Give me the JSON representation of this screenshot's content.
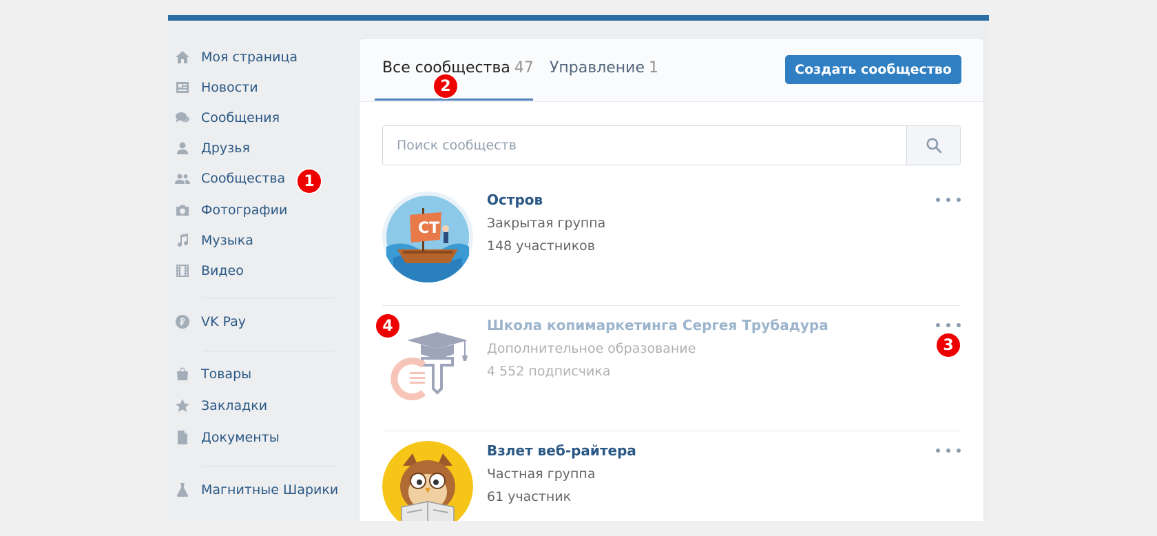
{
  "sidebar": {
    "items": [
      {
        "label": "Моя страница",
        "icon": "home-icon"
      },
      {
        "label": "Новости",
        "icon": "news-icon"
      },
      {
        "label": "Сообщения",
        "icon": "messages-icon"
      },
      {
        "label": "Друзья",
        "icon": "friend-icon"
      },
      {
        "label": "Сообщества",
        "icon": "communities-icon"
      },
      {
        "label": "Фотографии",
        "icon": "camera-icon"
      },
      {
        "label": "Музыка",
        "icon": "music-note-icon"
      },
      {
        "label": "Видео",
        "icon": "film-icon"
      },
      {
        "label": "VK Pay",
        "icon": "ruble-coin-icon"
      },
      {
        "label": "Товары",
        "icon": "shopping-bag-icon"
      },
      {
        "label": "Закладки",
        "icon": "star-icon"
      },
      {
        "label": "Документы",
        "icon": "document-icon"
      },
      {
        "label": "Магнитные Шарики",
        "icon": "flask-icon"
      }
    ]
  },
  "tabs": [
    {
      "label": "Все сообщества",
      "count": "47"
    },
    {
      "label": "Управление",
      "count": "1"
    }
  ],
  "create_button": "Создать сообщество",
  "search": {
    "placeholder": "Поиск сообществ",
    "value": ""
  },
  "groups": [
    {
      "name": "Остров",
      "type": "Закрытая группа",
      "members": "148 участников"
    },
    {
      "name": "Школа копимаркетинга Сергея Трубадура",
      "type": "Дополнительное образование",
      "members": "4 552 подписчика"
    },
    {
      "name": "Взлет веб-райтера",
      "type": "Частная группа",
      "members": "61 участник"
    }
  ],
  "markers": [
    "1",
    "2",
    "3",
    "4"
  ],
  "colors": {
    "accent": "#2a6ea3",
    "link": "#2a5885",
    "button": "#2f7fc2",
    "marker": "#ee0000",
    "background": "#edeef0"
  }
}
